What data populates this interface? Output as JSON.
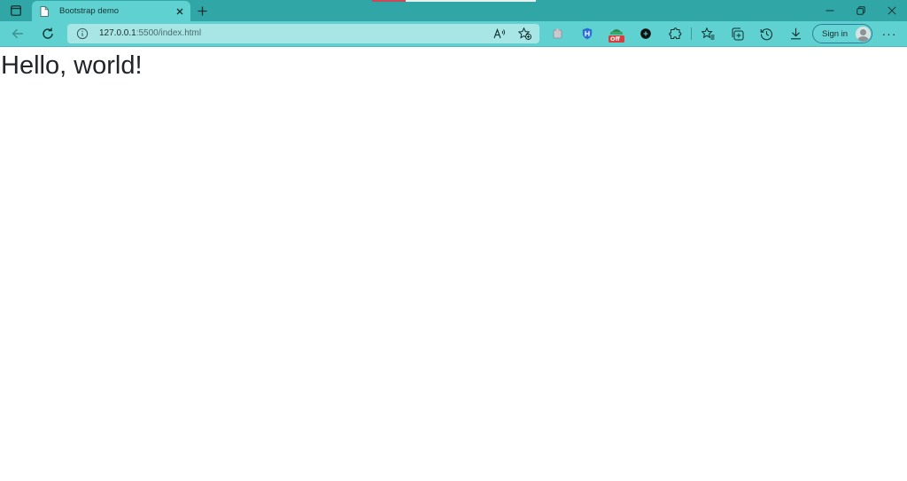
{
  "tabbar": {
    "tab": {
      "title": "Bootstrap demo",
      "favicon": "page-icon",
      "close": "close-icon"
    },
    "new_tab": "plus-icon",
    "window_controls": [
      "minimize-icon",
      "restore-icon",
      "close-icon"
    ]
  },
  "toolbar": {
    "back": "back-arrow-icon",
    "reload": "reload-icon",
    "address": {
      "url_host": "127.0.0.1",
      "url_rest": ":5500/index.html"
    },
    "extensions": [
      "puzzle-ext-icon",
      "shield-ext-icon",
      "coupon-ext-icon",
      "ext-black-icon",
      "extensions-icon"
    ],
    "coupon_badge": "Off",
    "actions": [
      "favorites-icon",
      "collections-icon",
      "history-icon",
      "downloads-icon"
    ],
    "signin_label": "Sign in",
    "more_label": "···"
  },
  "page": {
    "heading": "Hello, world!"
  },
  "colors": {
    "tabstrip": "#31a6a6",
    "toolbar": "#5fd1d1",
    "omnibox": "#a8e6e6",
    "heading_text": "#212529"
  }
}
